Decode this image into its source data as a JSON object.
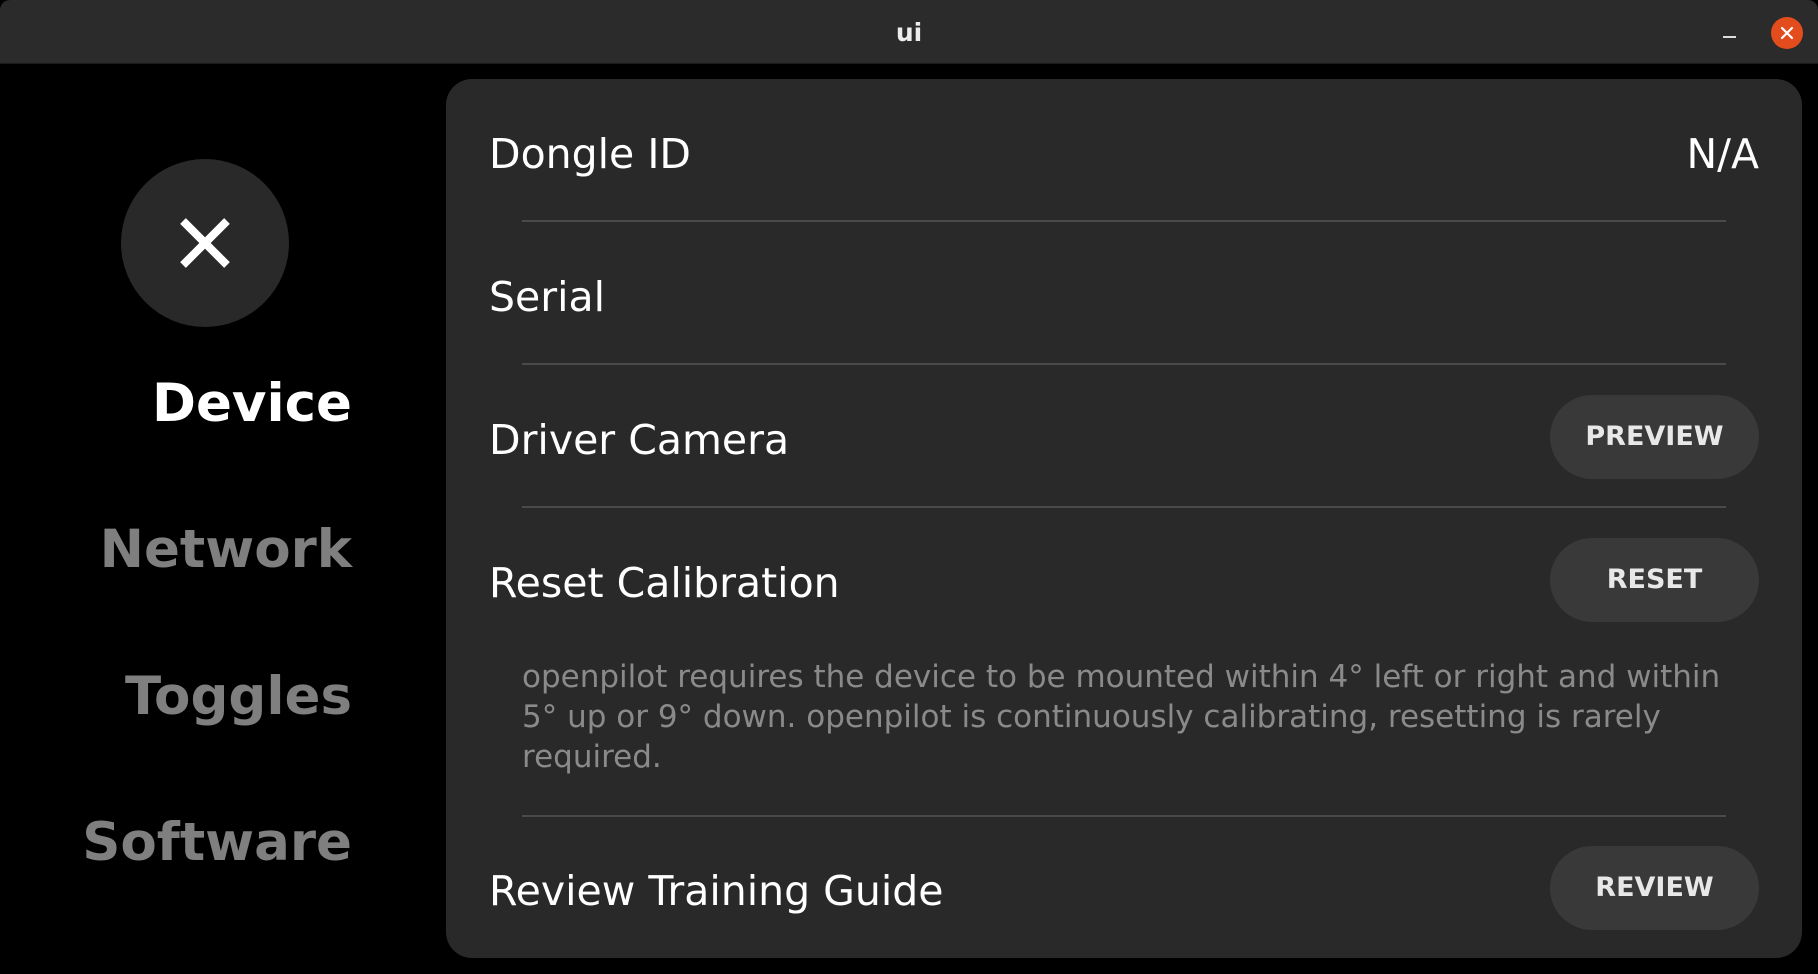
{
  "window": {
    "title": "ui"
  },
  "sidebar": {
    "items": [
      {
        "label": "Device",
        "active": true
      },
      {
        "label": "Network",
        "active": false
      },
      {
        "label": "Toggles",
        "active": false
      },
      {
        "label": "Software",
        "active": false
      }
    ]
  },
  "panel": {
    "dongle": {
      "label": "Dongle ID",
      "value": "N/A"
    },
    "serial": {
      "label": "Serial"
    },
    "driver_camera": {
      "label": "Driver Camera",
      "button": "PREVIEW"
    },
    "reset_calibration": {
      "label": "Reset Calibration",
      "button": "RESET",
      "description": "openpilot requires the device to be mounted within 4° left or right and within 5° up or 9° down. openpilot is continuously calibrating, resetting is rarely required."
    },
    "training_guide": {
      "label": "Review Training Guide",
      "button": "REVIEW"
    }
  },
  "colors": {
    "titlebar": "#2b2b2b",
    "panel": "#292929",
    "button": "#393939",
    "close_accent": "#e34c1c",
    "inactive_nav": "#7f7f7f"
  },
  "icons": [
    "minimize-icon",
    "window-close-icon",
    "close-x-icon"
  ]
}
